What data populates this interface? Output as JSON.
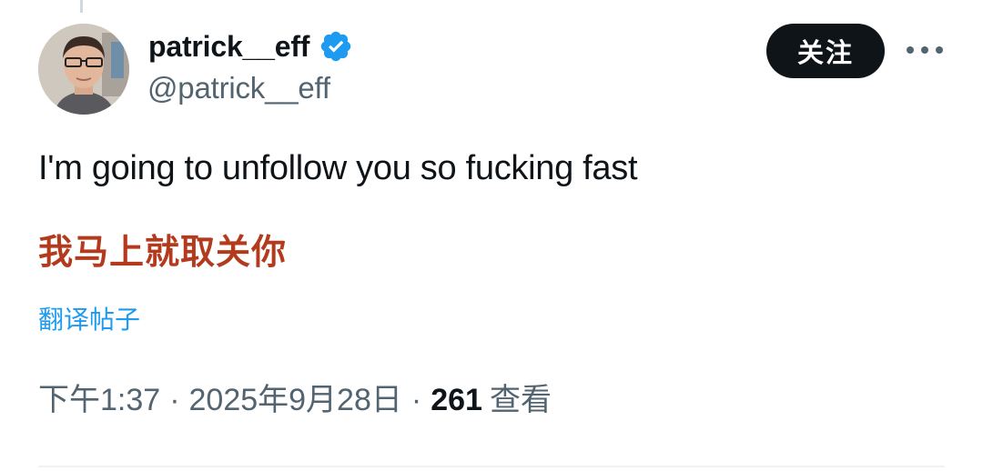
{
  "author": {
    "display_name": "patrick__eff",
    "handle": "@patrick__eff",
    "verified": true
  },
  "actions": {
    "follow_label": "关注",
    "more_icon": "more-horizontal-icon"
  },
  "post": {
    "text": "I'm going to unfollow you so fucking fast",
    "translation": "我马上就取关你",
    "translate_link": "翻译帖子"
  },
  "meta": {
    "time": "下午1:37",
    "separator": "·",
    "date": "2025年9月28日",
    "views_count": "261",
    "views_label": "查看"
  },
  "colors": {
    "text_primary": "#0f1419",
    "text_secondary": "#536471",
    "link": "#1d9bf0",
    "verified_badge": "#1d9bf0",
    "translation": "#b33a1c",
    "follow_button_bg": "#0f1419"
  }
}
